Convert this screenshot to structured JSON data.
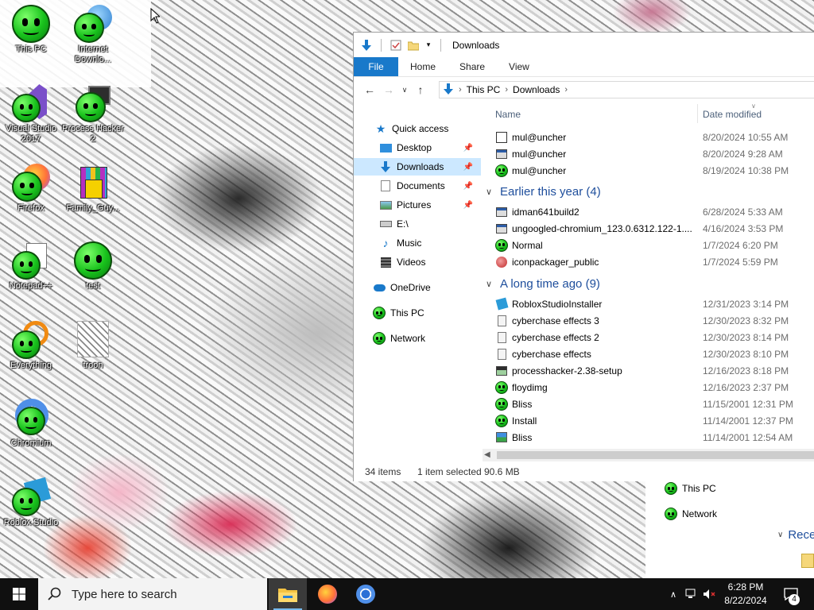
{
  "desktop": {
    "icons": [
      {
        "label": "This PC"
      },
      {
        "label": "Internet Downlo..."
      },
      {
        "label": "Visual Studio 2017"
      },
      {
        "label": "Process Hacker 2"
      },
      {
        "label": "Firefox"
      },
      {
        "label": "Family_Guy..."
      },
      {
        "label": "Notepad++"
      },
      {
        "label": "test"
      },
      {
        "label": "Everything"
      },
      {
        "label": "troon"
      },
      {
        "label": "Chromium"
      },
      {
        "label": "Roblox Studio"
      }
    ]
  },
  "bg_explorer": {
    "nav": [
      {
        "label": "This PC"
      },
      {
        "label": "Network"
      }
    ],
    "section": "Rece"
  },
  "explorer": {
    "title": "Downloads",
    "ribbon_tabs": [
      "File",
      "Home",
      "Share",
      "View"
    ],
    "address": {
      "crumbs": [
        "This PC",
        "Downloads"
      ]
    },
    "nav_pane": [
      {
        "label": "Quick access",
        "icon": "star-icon"
      },
      {
        "label": "Desktop",
        "icon": "desktop-icon",
        "pinned": true
      },
      {
        "label": "Downloads",
        "icon": "downloads-icon",
        "pinned": true,
        "selected": true
      },
      {
        "label": "Documents",
        "icon": "documents-icon",
        "pinned": true
      },
      {
        "label": "Pictures",
        "icon": "pictures-icon",
        "pinned": true
      },
      {
        "label": "E:\\",
        "icon": "drive-icon"
      },
      {
        "label": "Music",
        "icon": "music-icon"
      },
      {
        "label": "Videos",
        "icon": "videos-icon"
      },
      {
        "label": "OneDrive",
        "icon": "onedrive-icon"
      },
      {
        "label": "This PC",
        "icon": "smiley-icon"
      },
      {
        "label": "Network",
        "icon": "smiley-icon"
      }
    ],
    "columns": {
      "name": "Name",
      "date": "Date modified"
    },
    "groups": {
      "earlier_this_year": "Earlier this year (4)",
      "long_time_ago": "A long time ago (9)"
    },
    "files_today": [
      {
        "name": "mul@uncher",
        "date": "8/20/2024 10:55 AM",
        "icon": "installer-icon"
      },
      {
        "name": "mul@uncher",
        "date": "8/20/2024 9:28 AM",
        "icon": "exe-icon"
      },
      {
        "name": "mul@uncher",
        "date": "8/19/2024 10:38 PM",
        "icon": "smiley-icon"
      }
    ],
    "files_earlier": [
      {
        "name": "idman641build2",
        "date": "6/28/2024 5:33 AM",
        "icon": "exe-icon"
      },
      {
        "name": "ungoogled-chromium_123.0.6312.122-1....",
        "date": "4/16/2024 3:53 PM",
        "icon": "exe-icon"
      },
      {
        "name": "Normal",
        "date": "1/7/2024 6:20 PM",
        "icon": "smiley-icon"
      },
      {
        "name": "iconpackager_public",
        "date": "1/7/2024 5:59 PM",
        "icon": "package-icon"
      }
    ],
    "files_old": [
      {
        "name": "RobloxStudioInstaller",
        "date": "12/31/2023 3:14 PM",
        "icon": "roblox-icon"
      },
      {
        "name": "cyberchase effects 3",
        "date": "12/30/2023 8:32 PM",
        "icon": "file-icon"
      },
      {
        "name": "cyberchase effects 2",
        "date": "12/30/2023 8:14 PM",
        "icon": "file-icon"
      },
      {
        "name": "cyberchase effects",
        "date": "12/30/2023 8:10 PM",
        "icon": "file-icon"
      },
      {
        "name": "processhacker-2.38-setup",
        "date": "12/16/2023 8:18 PM",
        "icon": "exe-icon"
      },
      {
        "name": "floydimg",
        "date": "12/16/2023 2:37 PM",
        "icon": "smiley-icon"
      },
      {
        "name": "Bliss",
        "date": "11/15/2001 12:31 PM",
        "icon": "smiley-icon"
      },
      {
        "name": "Install",
        "date": "11/14/2001 12:37 PM",
        "icon": "smiley-icon"
      },
      {
        "name": "Bliss",
        "date": "11/14/2001 12:54 AM",
        "icon": "image-icon"
      }
    ],
    "status": {
      "items": "34 items",
      "selected": "1 item selected",
      "size": "90.6 MB"
    }
  },
  "taskbar": {
    "search_placeholder": "Type here to search",
    "time": "6:28 PM",
    "date": "8/22/2024",
    "notification_count": "4"
  },
  "colors": {
    "accent": "#1979ca",
    "selection": "#cce8ff",
    "taskbar": "#101010",
    "group_header": "#1e4e9c"
  }
}
